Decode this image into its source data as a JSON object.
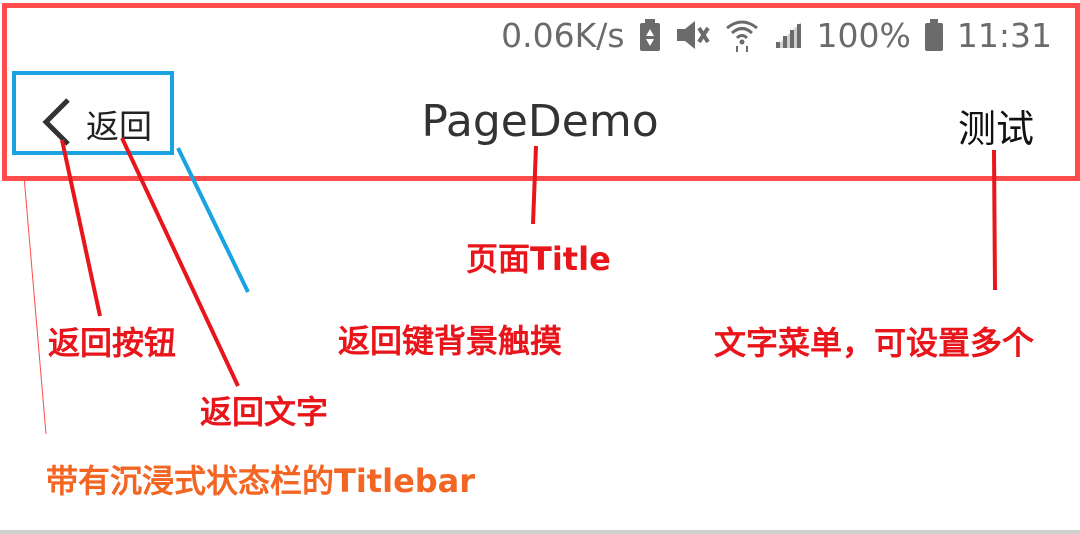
{
  "status_bar": {
    "net_speed": "0.06K/s",
    "battery_percent": "100%",
    "time": "11:31",
    "icons": [
      "battery-saver-icon",
      "vibrate-off-icon",
      "wifi-icon",
      "signal-icon",
      "battery-icon"
    ]
  },
  "titlebar": {
    "back_text": "返回",
    "title": "PageDemo",
    "menu_item": "测试"
  },
  "annotations": {
    "page_title": "页面Title",
    "back_button": "返回按钮",
    "back_touch": "返回键背景触摸",
    "menu": "文字菜单，可设置多个",
    "back_text": "返回文字",
    "titlebar": "带有沉浸式状态栏的Titlebar"
  },
  "colors": {
    "frame_red": "#ff4b4b",
    "annotation_red": "#e8151b",
    "touch_blue": "#1aa3e0",
    "titlebar_orange": "#f26522"
  }
}
